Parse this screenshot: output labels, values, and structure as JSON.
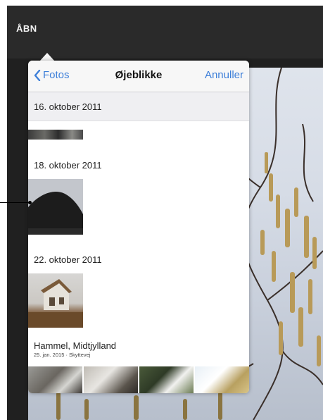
{
  "toolbar": {
    "open_label": "ÅBN"
  },
  "popover": {
    "nav": {
      "back_label": "Fotos",
      "title": "Øjeblikke",
      "cancel_label": "Annuller"
    },
    "moments": [
      {
        "date": "16. oktober 2011"
      },
      {
        "date": "18. oktober 2011"
      },
      {
        "date": "22. oktober 2011"
      }
    ],
    "location": {
      "title": "Hammel, Midtjylland",
      "subtitle": "25. jan. 2015 · Skyttevej"
    }
  },
  "colors": {
    "accent": "#3d7fd9",
    "toolbar_bg": "#2a2a2a",
    "section_bg": "#efeff2"
  },
  "icons": {
    "back": "chevron-left-icon"
  }
}
